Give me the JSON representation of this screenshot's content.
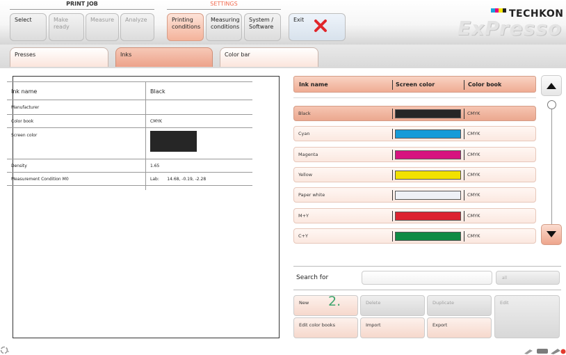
{
  "header": {
    "print_job_title": "PRINT JOB",
    "settings_title": "SETTINGS",
    "print_job_buttons": [
      {
        "label": "Select",
        "state": "normal"
      },
      {
        "label": "Make ready",
        "state": "dim"
      },
      {
        "label": "Measure",
        "state": "dim"
      },
      {
        "label": "Analyze",
        "state": "dim"
      }
    ],
    "settings_buttons": [
      {
        "label": "Printing conditions",
        "state": "active"
      },
      {
        "label": "Measuring conditions",
        "state": "normal"
      },
      {
        "label": "System / Software",
        "state": "normal"
      }
    ],
    "exit_label": "Exit",
    "logo_brand": "TECHKON",
    "logo_product": "ExPresso"
  },
  "tabs": [
    {
      "label": "Presses"
    },
    {
      "label": "Inks"
    },
    {
      "label": "Color bar"
    }
  ],
  "details": {
    "rows": [
      {
        "label": "Ink name",
        "value": "Black"
      },
      {
        "label": "Manufacturer",
        "value": ""
      },
      {
        "label": "Color book",
        "value": "CMYK"
      },
      {
        "label": "Screen color",
        "value": ""
      },
      {
        "label": "Density",
        "value": "1.65"
      },
      {
        "label": "Measurement Condition M0",
        "value": "Lab:      14.68, -0.19, -2.28"
      }
    ],
    "screen_color_hex": "#262626"
  },
  "ink_list": {
    "headers": {
      "name": "Ink name",
      "screen": "Screen color",
      "book": "Color book"
    },
    "rows": [
      {
        "name": "Black",
        "color": "#262626",
        "book": "CMYK"
      },
      {
        "name": "Cyan",
        "color": "#159bd8",
        "book": "CMYK"
      },
      {
        "name": "Magenta",
        "color": "#d7137f",
        "book": "CMYK"
      },
      {
        "name": "Yellow",
        "color": "#f2e100",
        "book": "CMYK"
      },
      {
        "name": "Paper white",
        "color": "#eef0f6",
        "book": "CMYK"
      },
      {
        "name": "M+Y",
        "color": "#dc2330",
        "book": "CMYK"
      },
      {
        "name": "C+Y",
        "color": "#0f8b45",
        "book": "CMYK"
      }
    ]
  },
  "search": {
    "label": "Search for",
    "value": "",
    "all_label": "all"
  },
  "actions": {
    "new": "New",
    "delete": "Delete",
    "duplicate": "Duplicate",
    "edit": "Edit",
    "edit_color_books": "Edit color books",
    "import": "Import",
    "export": "Export"
  },
  "annotation": "2.",
  "colors": {
    "accent": "#f26b4f",
    "active_fill": "#eda28a",
    "exit_x": "#e0262b"
  },
  "icons": {
    "scroll_up": "triangle-up-icon",
    "scroll_down": "triangle-down-icon",
    "exit": "close-icon",
    "status_left": "spinner-icon",
    "status_right": "device-icons"
  }
}
